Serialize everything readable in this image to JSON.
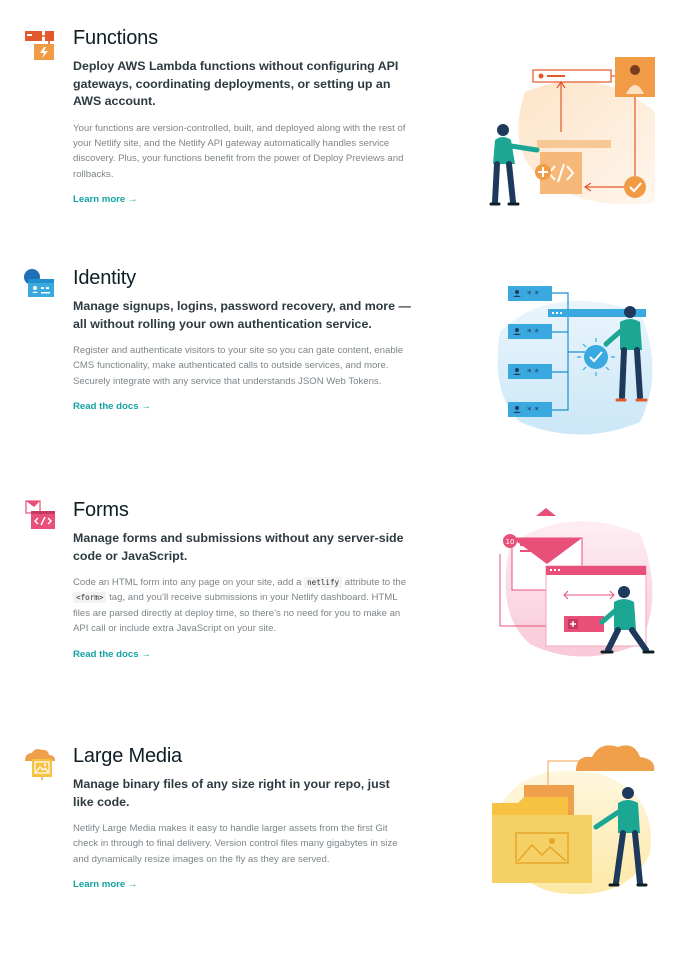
{
  "features": [
    {
      "title": "Functions",
      "lede": "Deploy AWS Lambda functions without configuring API gateways, coordinating deployments, or setting up an AWS account.",
      "body": "Your functions are version-controlled, built, and deployed along with the rest of your Netlify site, and the Netlify API gateway automatically handles service discovery. Plus, your functions benefit from the power of Deploy Previews and rollbacks.",
      "link": "Learn more →",
      "icon": "lambda-function-icon"
    },
    {
      "title": "Identity",
      "lede": "Manage signups, logins, password recovery, and more — all without rolling your own authentication service.",
      "body": "Register and authenticate visitors to your site so you can gate content, enable CMS functionality, make authenticated calls to outside services, and more. Securely integrate with any service that understands JSON Web Tokens.",
      "link": "Read the docs →",
      "icon": "identity-user-icon"
    },
    {
      "title": "Forms",
      "lede": "Manage forms and submissions without any server-side code or JavaScript.",
      "body_parts": {
        "p1": "Code an HTML form into any page on your site, add a ",
        "code1": "netlify",
        "p2": " attribute to the ",
        "code2": "<form>",
        "p3": " tag, and you’ll receive submissions in your Netlify dashboard. HTML files are parsed directly at deploy time, so there’s no need for you to make an API call or include extra JavaScript on your site."
      },
      "link": "Read the docs →",
      "icon": "form-code-icon"
    },
    {
      "title": "Large Media",
      "lede": "Manage binary files of any size right in your repo, just like code.",
      "body": "Netlify Large Media makes it easy to handle larger assets from the first Git check in through to final delivery. Version control files many gigabytes in size and dynamically resize images on the fly as they are served.",
      "link": "Learn more →",
      "icon": "large-media-cloud-icon"
    }
  ],
  "art": {
    "forms_badge": "10"
  },
  "colors": {
    "link": "#14a3a3",
    "functions_orange": "#f0a04b",
    "identity_blue": "#3aa9e0",
    "forms_pink": "#e8507a",
    "media_yellow": "#f5c242",
    "figure_teal": "#1ba794",
    "figure_navy": "#1d3a5c"
  }
}
